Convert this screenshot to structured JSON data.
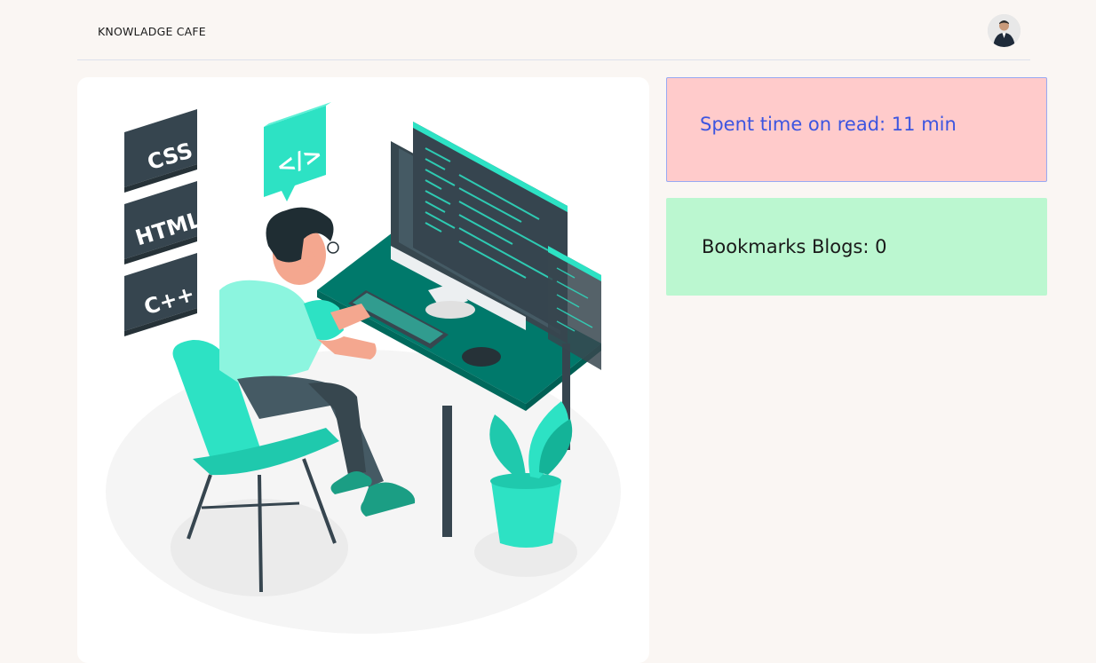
{
  "header": {
    "brand": "KNOWLADGE CAFE",
    "avatar_icon": "user-avatar-photo"
  },
  "hero": {
    "badges": [
      "CSS",
      "HTML",
      "C++"
    ],
    "code_bubble": "</>"
  },
  "sidebar": {
    "spent_time_text": "Spent time on read: 11 min",
    "bookmarks_text": "Bookmarks Blogs: 0"
  },
  "colors": {
    "page_bg": "#faf6f3",
    "time_card_bg": "#ffcbcb",
    "time_card_text": "#3c55e0",
    "bookmark_card_bg": "#bbf7d0",
    "accent_teal": "#2de2c4",
    "dark_slate": "#36454f"
  }
}
